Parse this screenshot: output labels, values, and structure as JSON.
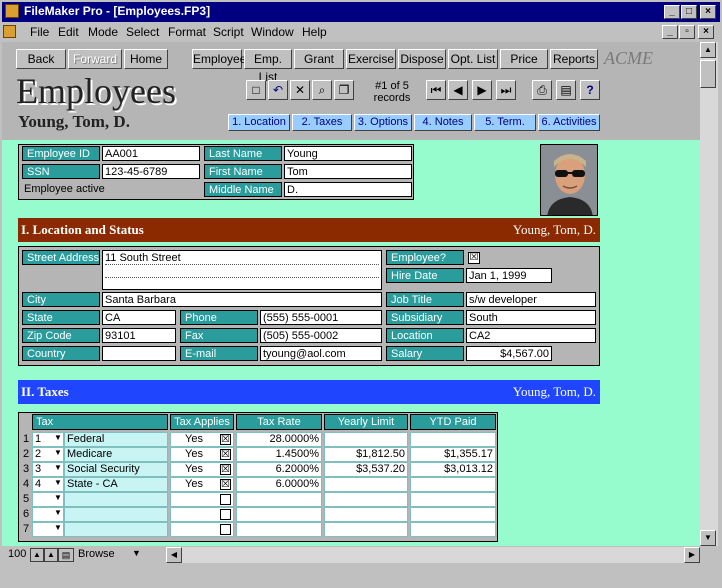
{
  "window": {
    "title": "FileMaker Pro - [Employees.FP3]"
  },
  "menu": [
    "File",
    "Edit",
    "Mode",
    "Select",
    "Format",
    "Script",
    "Window",
    "Help"
  ],
  "nav_buttons": [
    "Back",
    "Forward",
    "Home",
    "Employee",
    "Emp. List",
    "Grant",
    "Exercise",
    "Dispose",
    "Opt. List",
    "Price",
    "Reports"
  ],
  "brand": "ACME",
  "page_title": "Employees",
  "record_status": {
    "line1": "#1 of 5",
    "line2": "records"
  },
  "employee_name": "Young, Tom, D.",
  "tabs": [
    "1. Location",
    "2. Taxes",
    "3. Options",
    "4. Notes",
    "5. Term.",
    "6. Activities"
  ],
  "id_block": {
    "employee_id_label": "Employee ID",
    "employee_id": "AA001",
    "ssn_label": "SSN",
    "ssn": "123-45-6789",
    "active_label": "Employee active",
    "last_name_label": "Last Name",
    "last_name": "Young",
    "first_name_label": "First Name",
    "first_name": "Tom",
    "middle_name_label": "Middle Name",
    "middle_name": "D."
  },
  "location": {
    "section_title": "I. Location and Status",
    "section_name": "Young, Tom, D.",
    "street_label": "Street Address",
    "street": "11 South Street",
    "city_label": "City",
    "city": "Santa Barbara",
    "state_label": "State",
    "state": "CA",
    "zip_label": "Zip Code",
    "zip": "93101",
    "country_label": "Country",
    "country": "",
    "phone_label": "Phone",
    "phone": "(555) 555-0001",
    "fax_label": "Fax",
    "fax": "(505) 555-0002",
    "email_label": "E-mail",
    "email": "tyoung@aol.com",
    "employee_q_label": "Employee?",
    "employee_q": "☒",
    "hire_label": "Hire Date",
    "hire": "Jan 1, 1999",
    "job_label": "Job Title",
    "job": "s/w developer",
    "subsidiary_label": "Subsidiary",
    "subsidiary": "South",
    "loc_label": "Location",
    "loc": "CA2",
    "salary_label": "Salary",
    "salary": "$4,567.00"
  },
  "taxes": {
    "section_title": "II. Taxes",
    "section_name": "Young, Tom, D.",
    "headers": [
      "Tax",
      "Tax Applies",
      "Tax Rate",
      "Yearly Limit",
      "YTD Paid"
    ],
    "rows": [
      {
        "n": "1",
        "num": "1",
        "name": "Federal",
        "applies": "Yes",
        "checked": "☒",
        "rate": "28.0000%",
        "limit": "",
        "ytd": ""
      },
      {
        "n": "2",
        "num": "2",
        "name": "Medicare",
        "applies": "Yes",
        "checked": "☒",
        "rate": "1.4500%",
        "limit": "$1,812.50",
        "ytd": "$1,355.17"
      },
      {
        "n": "3",
        "num": "3",
        "name": "Social Security",
        "applies": "Yes",
        "checked": "☒",
        "rate": "6.2000%",
        "limit": "$3,537.20",
        "ytd": "$3,013.12"
      },
      {
        "n": "4",
        "num": "4",
        "name": "State - CA",
        "applies": "Yes",
        "checked": "☒",
        "rate": "6.0000%",
        "limit": "",
        "ytd": ""
      },
      {
        "n": "5",
        "num": "",
        "name": "",
        "applies": "",
        "checked": "",
        "rate": "",
        "limit": "",
        "ytd": ""
      },
      {
        "n": "6",
        "num": "",
        "name": "",
        "applies": "",
        "checked": "",
        "rate": "",
        "limit": "",
        "ytd": ""
      },
      {
        "n": "7",
        "num": "",
        "name": "",
        "applies": "",
        "checked": "",
        "rate": "",
        "limit": "",
        "ytd": ""
      }
    ]
  },
  "status": {
    "zoom": "100",
    "mode": "Browse"
  }
}
